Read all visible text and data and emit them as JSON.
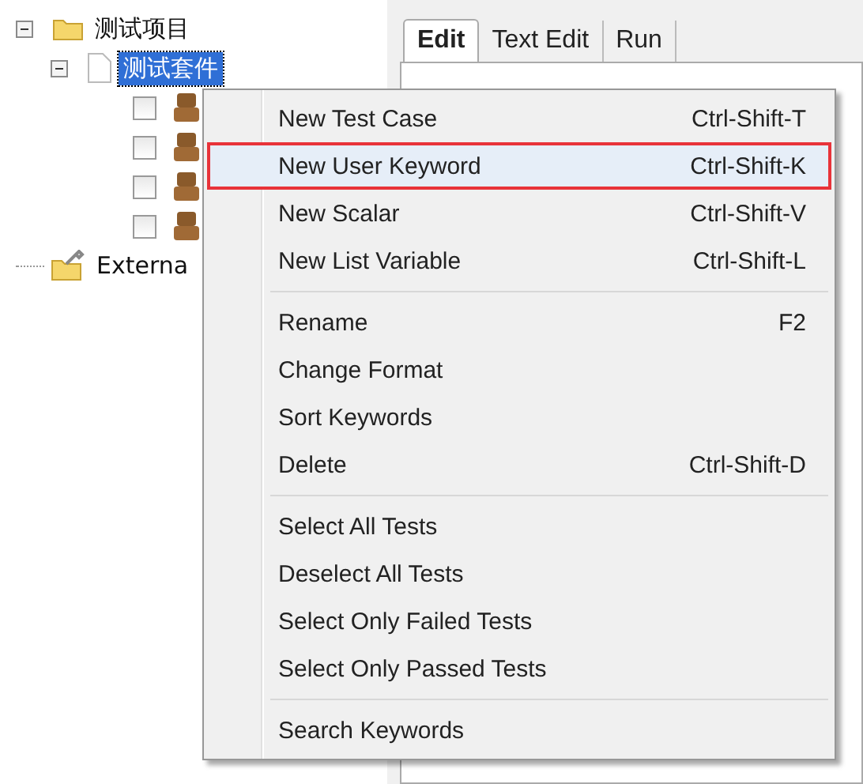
{
  "tree": [
    {
      "label": "测试项目",
      "kind": "folder",
      "expanded": true,
      "selected": false,
      "children": [
        {
          "label": "测试套件",
          "kind": "file",
          "expanded": true,
          "selected": true,
          "children": [
            {
              "kind": "test",
              "checked": false
            },
            {
              "kind": "test",
              "checked": false
            },
            {
              "kind": "test",
              "checked": false
            },
            {
              "kind": "test",
              "checked": false
            }
          ]
        }
      ]
    },
    {
      "label": "Externa",
      "kind": "external",
      "selected": false
    }
  ],
  "tabs": [
    {
      "label": "Edit",
      "selected": true
    },
    {
      "label": "Text Edit",
      "selected": false
    },
    {
      "label": "Run",
      "selected": false
    }
  ],
  "context_menu": {
    "groups": [
      [
        {
          "label": "New Test Case",
          "shortcut": "Ctrl-Shift-T",
          "selected": false,
          "marked": false
        },
        {
          "label": "New User Keyword",
          "shortcut": "Ctrl-Shift-K",
          "selected": true,
          "marked": true
        },
        {
          "label": "New Scalar",
          "shortcut": "Ctrl-Shift-V",
          "selected": false,
          "marked": false
        },
        {
          "label": "New List Variable",
          "shortcut": "Ctrl-Shift-L",
          "selected": false,
          "marked": false
        }
      ],
      [
        {
          "label": "Rename",
          "shortcut": "F2",
          "selected": false,
          "marked": false
        },
        {
          "label": "Change Format",
          "selected": false,
          "marked": false
        },
        {
          "label": "Sort Keywords",
          "selected": false,
          "marked": false
        },
        {
          "label": "Delete",
          "shortcut": "Ctrl-Shift-D",
          "selected": false,
          "marked": false
        }
      ],
      [
        {
          "label": "Select All Tests",
          "selected": false,
          "marked": false
        },
        {
          "label": "Deselect All Tests",
          "selected": false,
          "marked": false
        },
        {
          "label": "Select Only Failed Tests",
          "selected": false,
          "marked": false
        },
        {
          "label": "Select Only Passed Tests",
          "selected": false,
          "marked": false
        }
      ],
      [
        {
          "label": "Search Keywords",
          "selected": false,
          "marked": false
        }
      ]
    ]
  }
}
